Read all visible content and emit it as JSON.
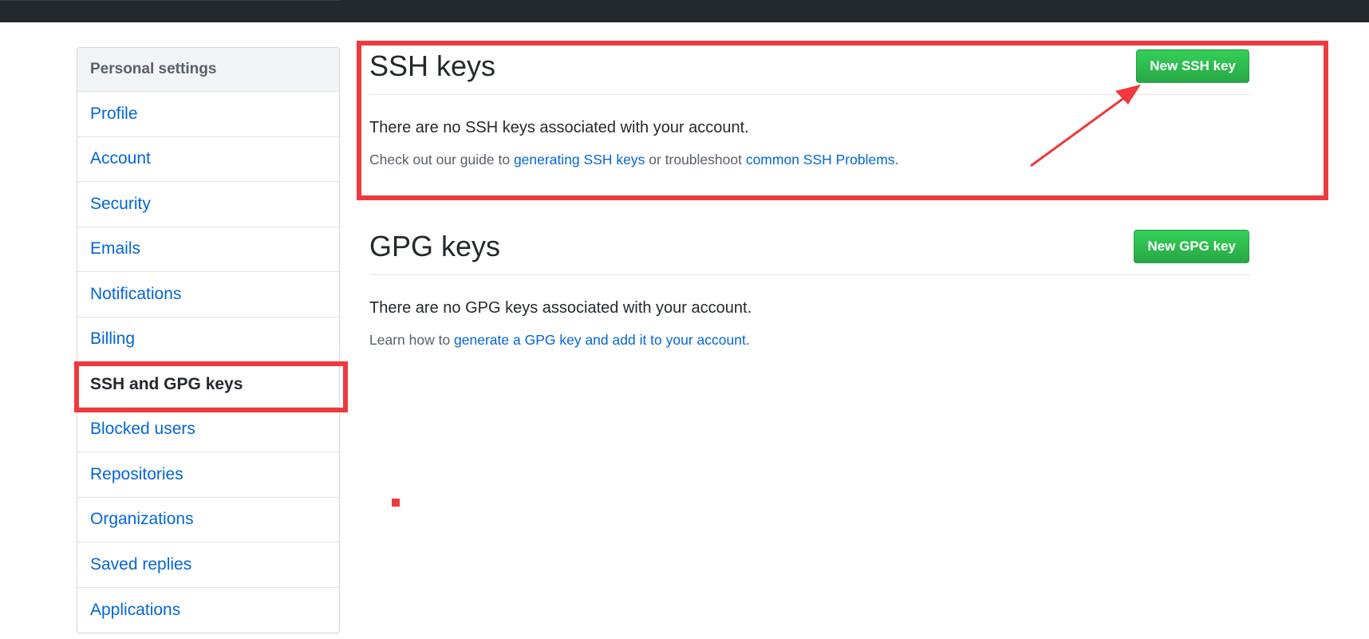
{
  "sidebar": {
    "header": "Personal settings",
    "items": [
      {
        "label": "Profile"
      },
      {
        "label": "Account"
      },
      {
        "label": "Security"
      },
      {
        "label": "Emails"
      },
      {
        "label": "Notifications"
      },
      {
        "label": "Billing"
      },
      {
        "label": "SSH and GPG keys"
      },
      {
        "label": "Blocked users"
      },
      {
        "label": "Repositories"
      },
      {
        "label": "Organizations"
      },
      {
        "label": "Saved replies"
      },
      {
        "label": "Applications"
      }
    ],
    "selected_index": 6
  },
  "ssh": {
    "title": "SSH keys",
    "button_label": "New SSH key",
    "blank_text": "There are no SSH keys associated with your account.",
    "help_prefix": "Check out our guide to ",
    "help_link1": "generating SSH keys",
    "help_middle": " or troubleshoot ",
    "help_link2": "common SSH Problems",
    "help_suffix": "."
  },
  "gpg": {
    "title": "GPG keys",
    "button_label": "New GPG key",
    "blank_text": "There are no GPG keys associated with your account.",
    "help_prefix": "Learn how to ",
    "help_link": "generate a GPG key and add it to your account",
    "help_suffix": "."
  },
  "colors": {
    "annotation": "#ee3a3e",
    "link": "#0366d6",
    "button": "#28a745",
    "topbar": "#24292e"
  }
}
